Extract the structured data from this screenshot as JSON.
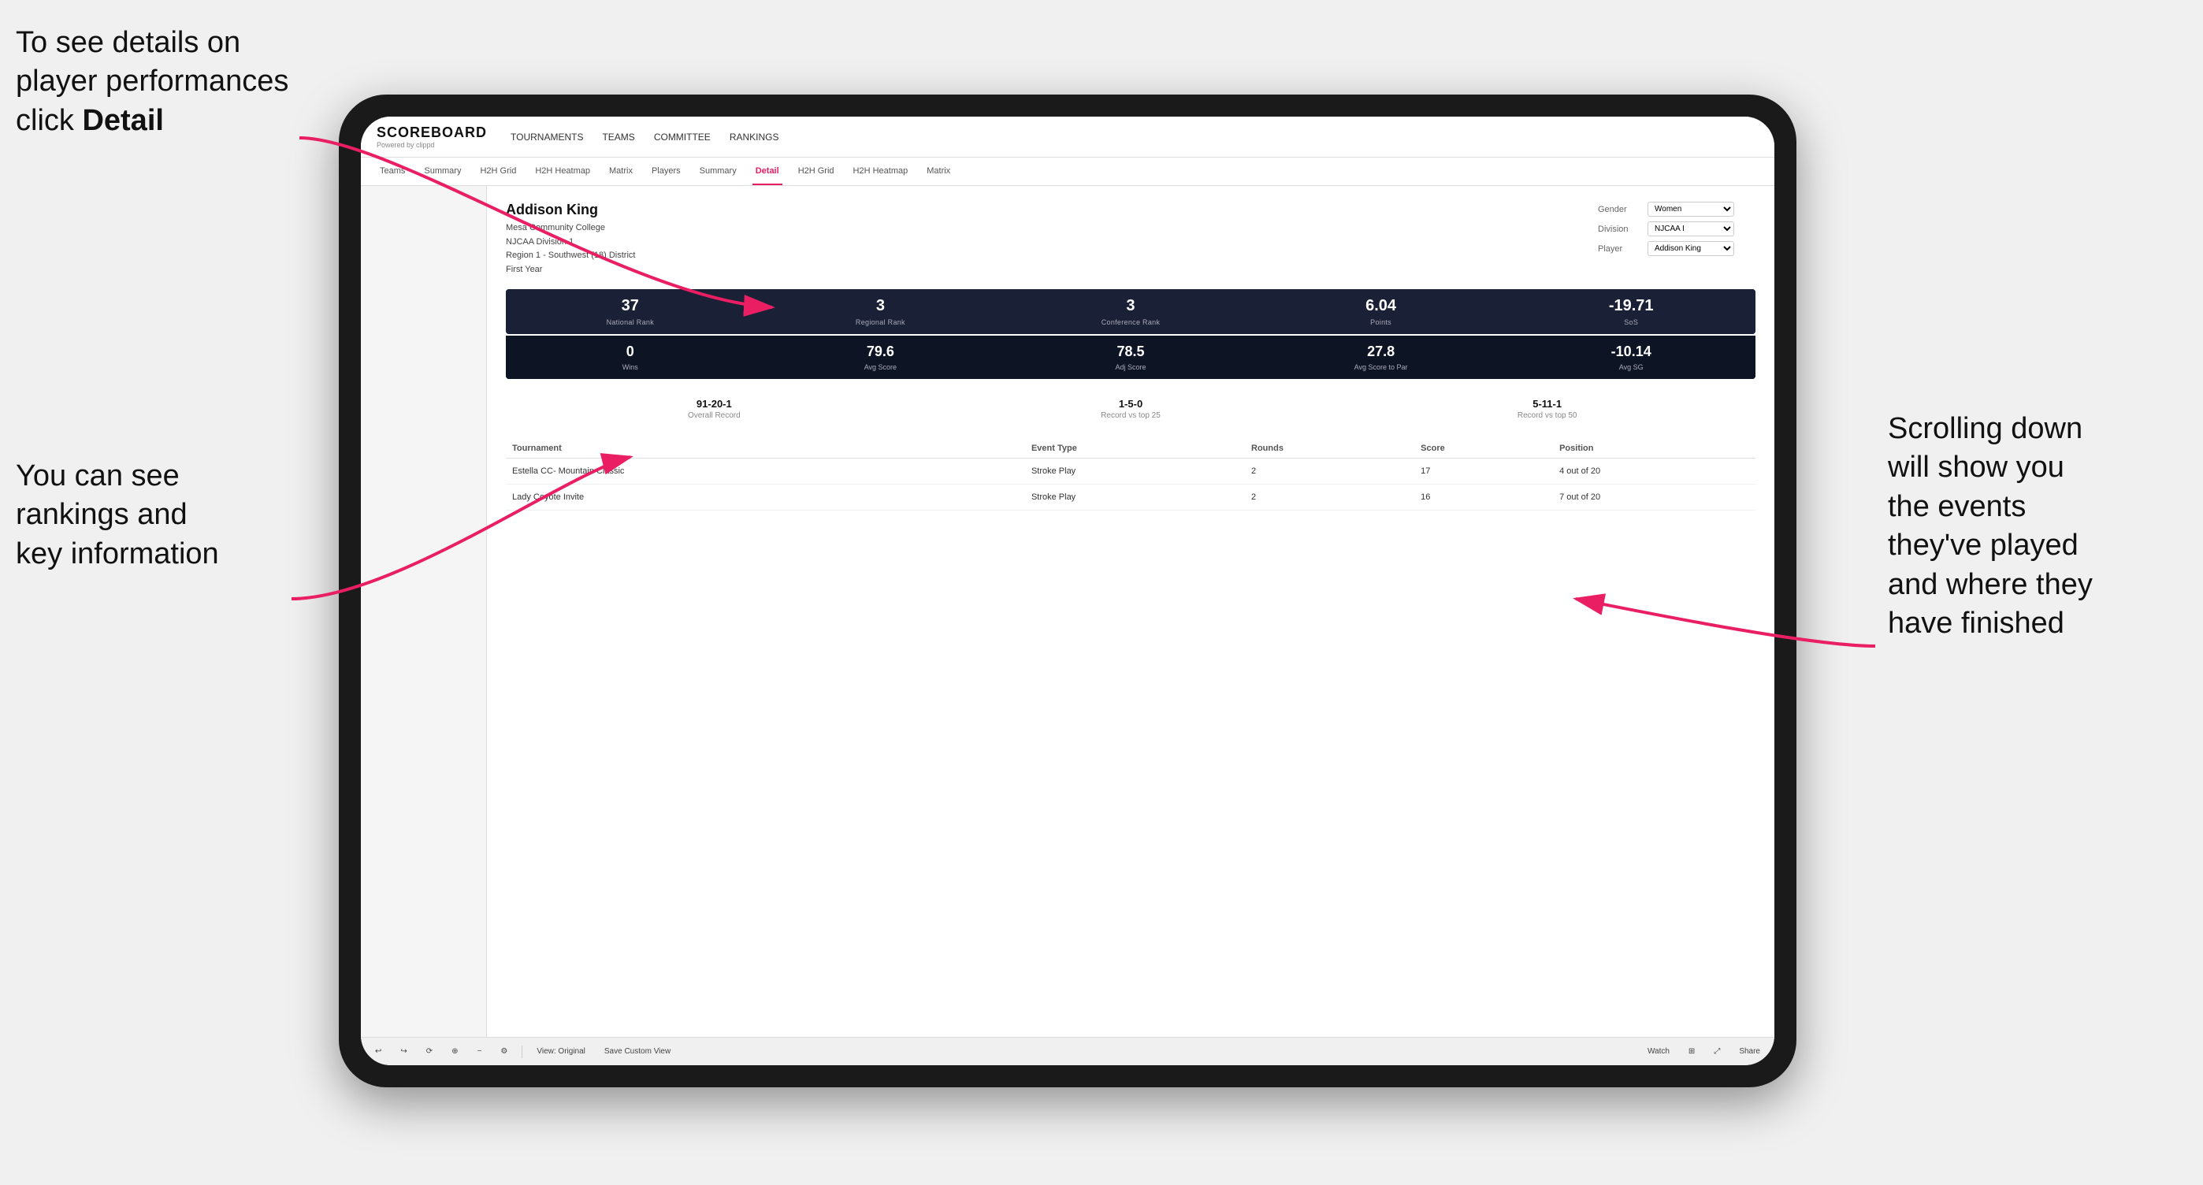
{
  "annotations": {
    "top_left": {
      "line1": "To see details on",
      "line2": "player performances",
      "line3_prefix": "click ",
      "line3_bold": "Detail"
    },
    "bottom_left": {
      "line1": "You can see",
      "line2": "rankings and",
      "line3": "key information"
    },
    "right": {
      "line1": "Scrolling down",
      "line2": "will show you",
      "line3": "the events",
      "line4": "they've played",
      "line5": "and where they",
      "line6": "have finished"
    }
  },
  "nav": {
    "logo": "SCOREBOARD",
    "logo_sub": "Powered by clippd",
    "items": [
      "TOURNAMENTS",
      "TEAMS",
      "COMMITTEE",
      "RANKINGS"
    ]
  },
  "sub_tabs": [
    "Teams",
    "Summary",
    "H2H Grid",
    "H2H Heatmap",
    "Matrix",
    "Players",
    "Summary",
    "Detail",
    "H2H Grid",
    "H2H Heatmap",
    "Matrix"
  ],
  "active_tab": "Detail",
  "player": {
    "name": "Addison King",
    "school": "Mesa Community College",
    "division": "NJCAA Division 1",
    "region": "Region 1 - Southwest (18) District",
    "year": "First Year"
  },
  "controls": {
    "gender_label": "Gender",
    "gender_value": "Women",
    "division_label": "Division",
    "division_value": "NJCAA I",
    "player_label": "Player",
    "player_value": "Addison King"
  },
  "stats_row1": [
    {
      "value": "37",
      "label": "National Rank"
    },
    {
      "value": "3",
      "label": "Regional Rank"
    },
    {
      "value": "3",
      "label": "Conference Rank"
    },
    {
      "value": "6.04",
      "label": "Points"
    },
    {
      "value": "-19.71",
      "label": "SoS"
    }
  ],
  "stats_row2": [
    {
      "value": "0",
      "label": "Wins"
    },
    {
      "value": "79.6",
      "label": "Avg Score"
    },
    {
      "value": "78.5",
      "label": "Adj Score"
    },
    {
      "value": "27.8",
      "label": "Avg Score to Par"
    },
    {
      "value": "-10.14",
      "label": "Avg SG"
    }
  ],
  "records": [
    {
      "value": "91-20-1",
      "label": "Overall Record"
    },
    {
      "value": "1-5-0",
      "label": "Record vs top 25"
    },
    {
      "value": "5-11-1",
      "label": "Record vs top 50"
    }
  ],
  "table": {
    "headers": [
      "Tournament",
      "",
      "Event Type",
      "Rounds",
      "Score",
      "Position"
    ],
    "rows": [
      {
        "tournament": "Estella CC- Mountain Classic",
        "event_type": "Stroke Play",
        "rounds": "2",
        "score": "17",
        "position": "4 out of 20"
      },
      {
        "tournament": "Lady Coyote Invite",
        "event_type": "Stroke Play",
        "rounds": "2",
        "score": "16",
        "position": "7 out of 20"
      }
    ]
  },
  "toolbar": {
    "view_label": "View: Original",
    "save_label": "Save Custom View",
    "watch_label": "Watch",
    "share_label": "Share"
  }
}
